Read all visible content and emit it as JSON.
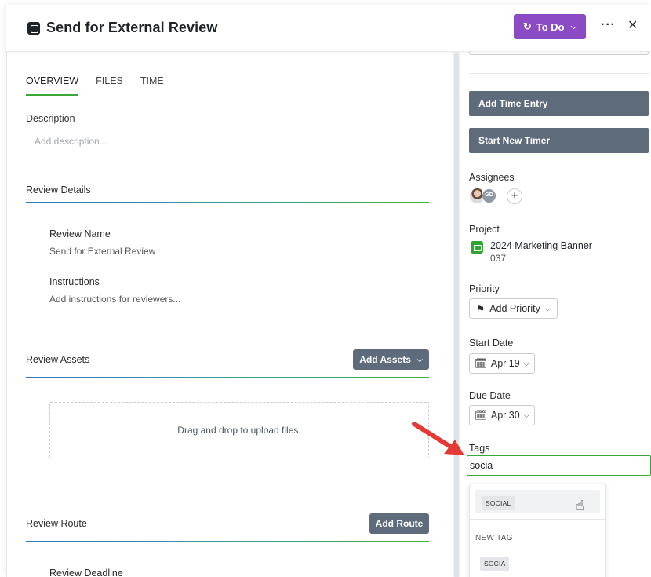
{
  "header": {
    "title": "Send for External Review",
    "status_label": "To Do",
    "more_label": "···",
    "close_label": "✕"
  },
  "tabs": [
    {
      "label": "OVERVIEW",
      "active": true
    },
    {
      "label": "FILES",
      "active": false
    },
    {
      "label": "TIME",
      "active": false
    }
  ],
  "description": {
    "label": "Description",
    "placeholder": "Add description..."
  },
  "review_details": {
    "title": "Review Details",
    "name_label": "Review Name",
    "name_value": "Send for External Review",
    "instructions_label": "Instructions",
    "instructions_placeholder": "Add instructions for reviewers..."
  },
  "review_assets": {
    "title": "Review Assets",
    "add_button": "Add Assets",
    "dropzone_text": "Drag and drop to upload files."
  },
  "review_route": {
    "title": "Review Route",
    "add_button": "Add Route",
    "deadline_label": "Review Deadline"
  },
  "sidebar": {
    "add_time_entry": "Add Time Entry",
    "start_timer": "Start New Timer",
    "assignees_label": "Assignees",
    "assignee_initials": "GD",
    "add_assignee": "+",
    "project_label": "Project",
    "project_name": "2024 Marketing Banner",
    "project_number": "037",
    "priority_label": "Priority",
    "priority_button": "Add Priority",
    "start_date_label": "Start Date",
    "start_date": "Apr 19",
    "due_date_label": "Due Date",
    "due_date": "Apr 30",
    "tags_label": "Tags",
    "tags_input_value": "socia"
  },
  "tag_dropdown": {
    "match": "SOCIAL",
    "new_tag_label": "NEW TAG",
    "new_tag_value": "SOCIA"
  },
  "colors": {
    "status": "#8b4bc5",
    "dark_button": "#5d6b7a",
    "accent_green": "#3aa635",
    "project_icon": "#2ea52f",
    "arrow": "#e53935"
  }
}
